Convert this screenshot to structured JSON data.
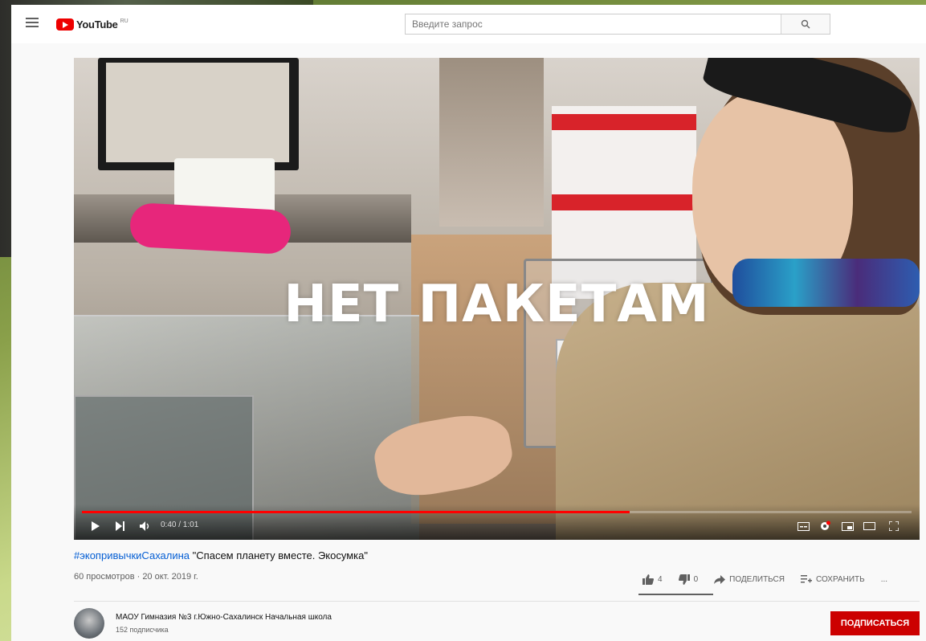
{
  "masthead": {
    "logo_text": "YouTube",
    "logo_region": "RU",
    "search_placeholder": "Введите запрос"
  },
  "player": {
    "overlay_title": "НЕТ ПАКЕТАМ",
    "time": "0:40 / 1:01",
    "progress_fraction": 0.66
  },
  "video": {
    "hashtag": "#экопривычкиСахалина",
    "title": "\"Спасем планету вместе. Экосумка\"",
    "meta": "60 просмотров · 20 окт. 2019 г.",
    "likes": "4",
    "dislikes": "0",
    "share_label": "ПОДЕЛИТЬСЯ",
    "save_label": "СОХРАНИТЬ",
    "more_label": "...",
    "like_ratio": 1.0
  },
  "channel": {
    "name": "МАОУ Гимназия №3 г.Южно-Сахалинск Начальная школа",
    "subscribers": "152 подписчика",
    "subscribe_label": "ПОДПИСАТЬСЯ"
  },
  "colors": {
    "accent_red": "#cc0000",
    "link_blue": "#065fd4",
    "progress_red": "#ff0000"
  }
}
